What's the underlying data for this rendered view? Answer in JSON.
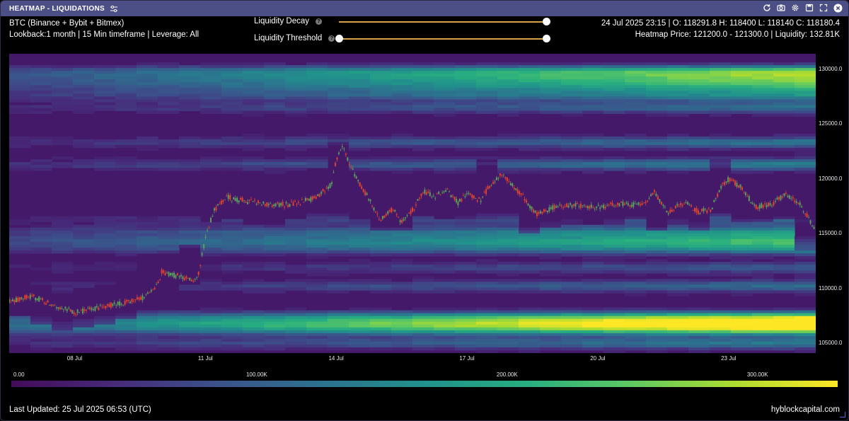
{
  "window": {
    "title": "HEATMAP - LIQUIDATIONS"
  },
  "info": {
    "line1": "BTC (Binance + Bybit + Bitmex)",
    "line2": "Lookback:1 month | 15 Min timeframe | Leverage: All",
    "ohlc": "24 Jul 2025 23:15 | O: 118291.8 H: 118400 L: 118140 C: 118180.4",
    "hover": "Heatmap Price: 121200.0 - 121300.0 | Liquidity: 132.81K"
  },
  "controls": {
    "decay_label": "Liquidity Decay",
    "threshold_label": "Liquidity Threshold",
    "help_glyph": "?",
    "decay_value": 1.0,
    "threshold_min": 0.0,
    "threshold_max": 1.0
  },
  "footer": {
    "last_updated": "Last Updated: 25 Jul 2025 06:53 (UTC)",
    "brand": "hyblockcapital.com"
  },
  "icons": [
    "sliders-icon",
    "refresh-icon",
    "camera-icon",
    "gear-icon",
    "save-icon",
    "expand-icon",
    "close-icon"
  ],
  "colors": {
    "titlebar": "#4b4f86",
    "candle_up": "#5aa05a",
    "candle_down": "#e0442e",
    "slider": "#d9a24a",
    "viridis": [
      "#440a5a",
      "#472a7a",
      "#3b528b",
      "#2c728e",
      "#21918c",
      "#28ae80",
      "#5ec962",
      "#addc30",
      "#fde725"
    ]
  },
  "chart_data": {
    "type": "heatmap",
    "title": "",
    "xlabel": "",
    "ylabel": "",
    "x_ticks": [
      "08 Jul",
      "11 Jul",
      "14 Jul",
      "17 Jul",
      "20 Jul",
      "23 Jul"
    ],
    "y_ticks": [
      "130000.0",
      "125000.0",
      "120000.0",
      "115000.0",
      "110000.0",
      "105000.0"
    ],
    "ylim": [
      104100,
      131400
    ],
    "x_range_days": [
      6.5,
      25.0
    ],
    "colorbar": {
      "ticks": [
        "0.00",
        "100.00K",
        "200.00K",
        "300.00K"
      ],
      "range": [
        0,
        330000
      ],
      "colormap": "viridis"
    },
    "price_series": {
      "name": "",
      "x_days": [
        6.5,
        7.0,
        7.5,
        8.0,
        8.5,
        9.0,
        9.5,
        9.9,
        10.0,
        10.5,
        10.8,
        10.9,
        11.0,
        11.2,
        11.5,
        12.0,
        12.5,
        13.0,
        13.5,
        13.9,
        14.0,
        14.15,
        14.3,
        14.5,
        14.8,
        15.0,
        15.3,
        15.5,
        15.8,
        16.0,
        16.3,
        16.5,
        16.8,
        17.0,
        17.3,
        17.5,
        17.8,
        18.0,
        18.3,
        18.6,
        19.0,
        19.5,
        20.0,
        20.5,
        21.0,
        21.3,
        21.6,
        22.0,
        22.3,
        22.6,
        22.8,
        23.0,
        23.3,
        23.6,
        24.0,
        24.3,
        24.6,
        24.8,
        25.0
      ],
      "y_price": [
        108800,
        109300,
        108500,
        107800,
        108200,
        108600,
        109000,
        110200,
        111500,
        111000,
        110700,
        112500,
        114500,
        117200,
        118300,
        117900,
        117600,
        117700,
        118200,
        119500,
        121800,
        122900,
        121500,
        119800,
        117900,
        116200,
        117300,
        116000,
        117400,
        118800,
        118400,
        119100,
        117800,
        118700,
        118000,
        119200,
        120500,
        119600,
        118300,
        116700,
        117400,
        117600,
        117400,
        117700,
        117600,
        118800,
        116900,
        117900,
        117000,
        117200,
        119100,
        120000,
        119200,
        117400,
        117700,
        118600,
        117900,
        116700,
        115200
      ]
    },
    "liquidity_bands": [
      {
        "price": 129800,
        "value": 235000
      },
      {
        "price": 129100,
        "value": 200000
      },
      {
        "price": 128400,
        "value": 170000
      },
      {
        "price": 127600,
        "value": 145000
      },
      {
        "price": 126500,
        "value": 110000
      },
      {
        "price": 123300,
        "value": 120000
      },
      {
        "price": 121300,
        "value": 132810
      },
      {
        "price": 116200,
        "value": 90000
      },
      {
        "price": 115100,
        "value": 160000
      },
      {
        "price": 114300,
        "value": 190000
      },
      {
        "price": 113600,
        "value": 140000
      },
      {
        "price": 111900,
        "value": 80000
      },
      {
        "price": 110200,
        "value": 110000
      },
      {
        "price": 107400,
        "value": 215000
      },
      {
        "price": 106800,
        "value": 290000
      },
      {
        "price": 106200,
        "value": 230000
      },
      {
        "price": 105000,
        "value": 130000
      }
    ]
  }
}
